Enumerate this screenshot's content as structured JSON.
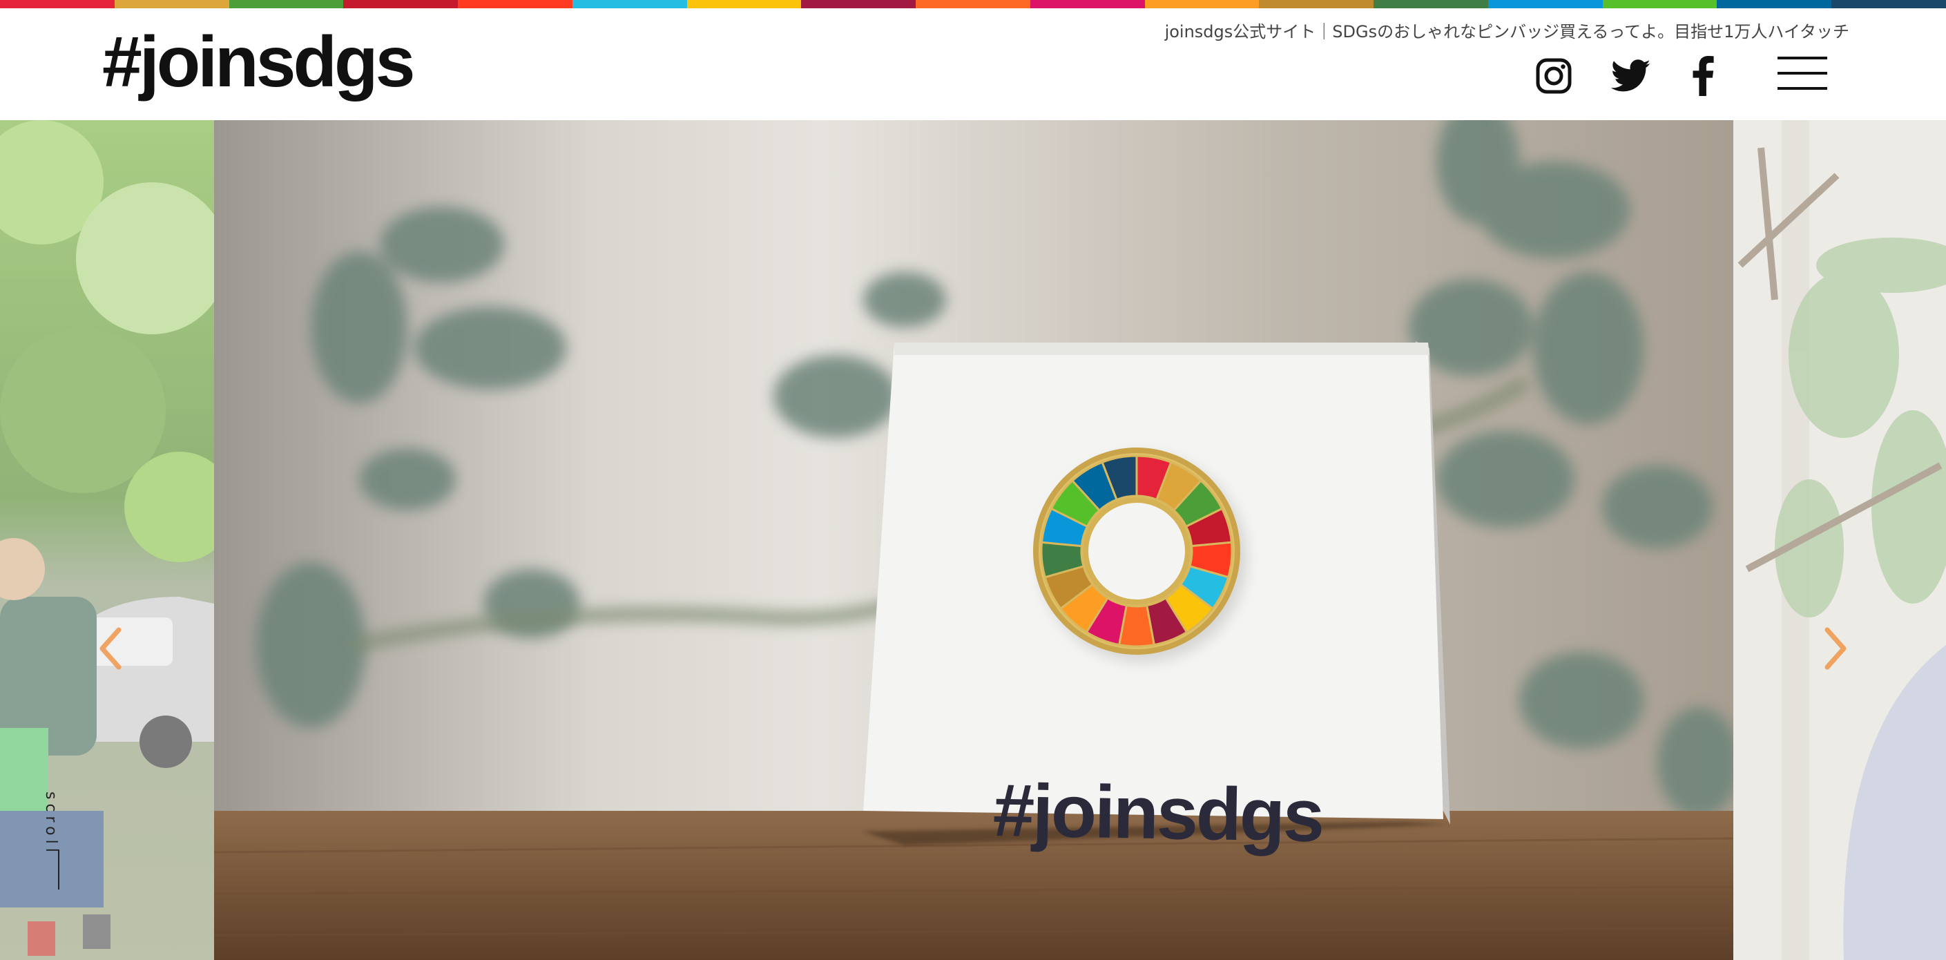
{
  "colors": {
    "rainbow": [
      "#e5243b",
      "#dda63a",
      "#4c9f38",
      "#c5192d",
      "#ff3a21",
      "#26bde2",
      "#fcc30b",
      "#a21942",
      "#fd6925",
      "#dd1367",
      "#fd9d24",
      "#bf8b2e",
      "#3f7e44",
      "#0a97d9",
      "#56c02b",
      "#00689d",
      "#19486a"
    ],
    "arrow": "#f0954a"
  },
  "header": {
    "logo": "#joinsdgs",
    "tagline": "joinsdgs公式サイト｜SDGsのおしゃれなピンバッジ買えるってよ。目指せ1万人ハイタッチ",
    "social": [
      "instagram-icon",
      "twitter-icon",
      "facebook-icon"
    ],
    "menu_icon": "hamburger-icon"
  },
  "hero": {
    "card_text": "#joinsdgs",
    "scroll_label": "scroll"
  }
}
